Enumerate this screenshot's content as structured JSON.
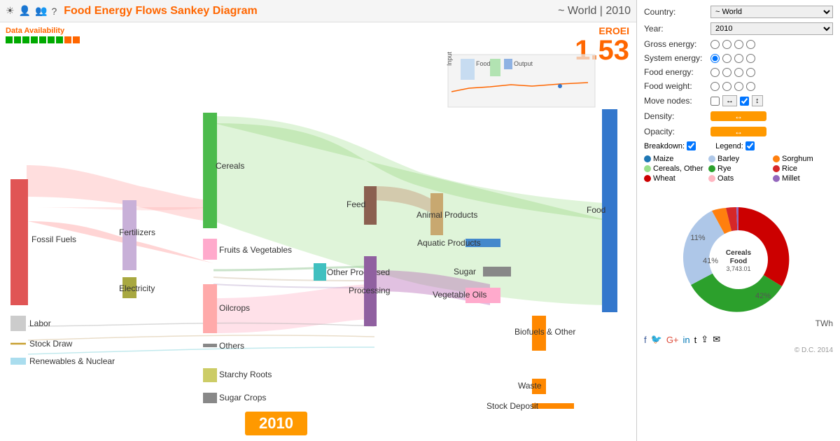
{
  "header": {
    "title": "Food Energy Flows Sankey Diagram",
    "world_year": "~ World | 2010",
    "icons": [
      "sun-icon",
      "person-icon",
      "group-icon",
      "question-icon"
    ]
  },
  "data_availability": {
    "label": "Data Availability",
    "dots": [
      true,
      true,
      true,
      true,
      true,
      true,
      true,
      true,
      true
    ]
  },
  "eroei": {
    "label": "EROEI",
    "value": "1.53"
  },
  "controls": {
    "country_label": "Country:",
    "country_value": "~ World",
    "year_label": "Year:",
    "year_value": "2010",
    "gross_energy_label": "Gross energy:",
    "system_energy_label": "System energy:",
    "food_energy_label": "Food energy:",
    "food_weight_label": "Food weight:",
    "move_nodes_label": "Move nodes:",
    "density_label": "Density:",
    "opacity_label": "Opacity:",
    "breakdown_label": "Breakdown:",
    "legend_label": "Legend:"
  },
  "legend": {
    "items": [
      {
        "label": "Maize",
        "color": "#1f77b4"
      },
      {
        "label": "Barley",
        "color": "#aec7e8"
      },
      {
        "label": "Sorghum",
        "color": "#ff7f0e"
      },
      {
        "label": "Cereals, Other",
        "color": "#98df8a"
      },
      {
        "label": "Rye",
        "color": "#2ca02c"
      },
      {
        "label": "Rice",
        "color": "#d62728"
      },
      {
        "label": "Wheat",
        "color": "#cc0000"
      },
      {
        "label": "Oats",
        "color": "#ffb6c1"
      },
      {
        "label": "Millet",
        "color": "#9467bd"
      }
    ]
  },
  "pie": {
    "center_label1": "Cereals",
    "center_label2": "Food",
    "center_value": "3,743.01",
    "segments": [
      {
        "label": "41%",
        "color": "#cc0000",
        "value": 41
      },
      {
        "label": "42%",
        "color": "#2ca02c",
        "value": 42
      },
      {
        "label": "11%",
        "color": "#aec7e8",
        "value": 11
      },
      {
        "label": "",
        "color": "#ff7f0e",
        "value": 3
      },
      {
        "label": "",
        "color": "#9467bd",
        "value": 1
      },
      {
        "label": "",
        "color": "#d62728",
        "value": 2
      }
    ]
  },
  "year_badge": "2010",
  "twh_label": "TWh",
  "copyright": "© D.C. 2014",
  "nodes": {
    "left": [
      "Fossil Fuels",
      "Fertilizers",
      "Labor",
      "Stock Draw",
      "Renewables & Nuclear",
      "Electricity"
    ],
    "middle": [
      "Cereals",
      "Fruits & Vegetables",
      "Oilcrops",
      "Others",
      "Starchy Roots",
      "Sugar Crops"
    ],
    "right_mid": [
      "Feed",
      "Animal Products",
      "Aquatic Products",
      "Other Processed",
      "Processing",
      "Sugar",
      "Vegetable Oils",
      "Biofuels & Other"
    ],
    "right": [
      "Food",
      "Waste",
      "Stock Deposit"
    ]
  }
}
